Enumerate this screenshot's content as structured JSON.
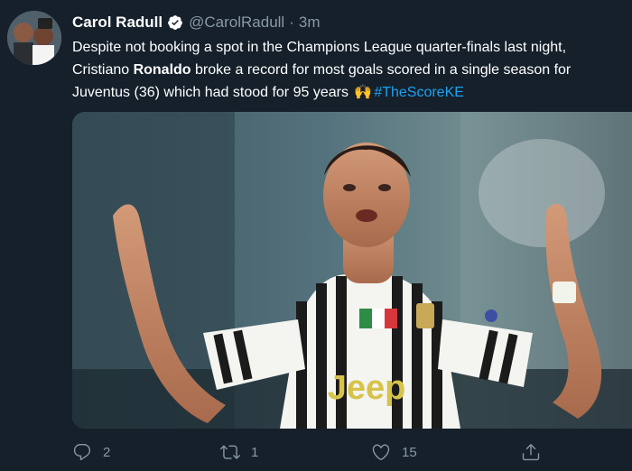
{
  "tweet": {
    "author": {
      "display_name": "Carol Radull",
      "handle": "@CarolRadull",
      "verified_icon": "verified-badge-icon"
    },
    "separator": "·",
    "time": "3m",
    "text": {
      "part1": "Despite not booking a spot in the Champions League quarter-finals last night, Cristiano ",
      "bold": "Ronaldo",
      "part2": " broke a record for most goals scored in a single season for Juventus (36) which had stood for 95 years ",
      "emoji": "🙌",
      "hashtag": "#TheScoreKE"
    },
    "media": {
      "jersey_text": "Jeep",
      "image_subject": "player-celebration-photo"
    },
    "actions": {
      "reply_count": "2",
      "retweet_count": "1",
      "like_count": "15"
    }
  },
  "colors": {
    "background": "#15202b",
    "text": "#ffffff",
    "secondary": "#8899a6",
    "link": "#1da1f2"
  }
}
